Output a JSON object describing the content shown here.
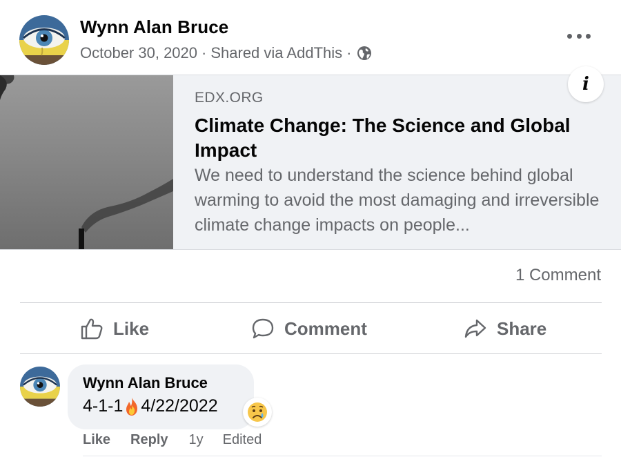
{
  "post": {
    "author": "Wynn Alan Bruce",
    "date": "October 30, 2020",
    "separator": "·",
    "shared_via": "Shared via AddThis",
    "privacy_icon": "globe-icon",
    "more_icon": "more-options-icon"
  },
  "link": {
    "domain": "EDX.ORG",
    "title": "Climate Change: The Science and Global Impact",
    "description": "We need to understand the science behind global warming to avoid the most damaging and irreversible climate change impacts on people...",
    "info_label": "i"
  },
  "stats": {
    "comments": "1 Comment"
  },
  "actions": {
    "like": "Like",
    "comment": "Comment",
    "share": "Share"
  },
  "comment": {
    "author": "Wynn Alan Bruce",
    "text_part1": "4-1-1",
    "emoji": "fire-emoji",
    "text_part2": "4/22/2022",
    "reaction": "sad-tear-emoji",
    "like": "Like",
    "reply": "Reply",
    "time": "1y",
    "edited": "Edited"
  },
  "colors": {
    "primary_text": "#050505",
    "secondary_text": "#65676b",
    "bubble_bg": "#f0f2f5",
    "divider": "#ced0d4"
  }
}
